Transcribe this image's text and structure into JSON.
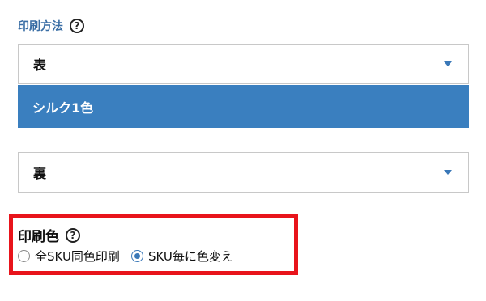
{
  "print_method": {
    "label": "印刷方法",
    "help": "?",
    "front_select": {
      "value": "表"
    },
    "front_highlight_option": "シルク1色",
    "back_select": {
      "value": "裏"
    }
  },
  "print_color": {
    "label": "印刷色",
    "help": "?",
    "options": [
      {
        "label": "全SKU同色印刷",
        "checked": false
      },
      {
        "label": "SKU毎に色変え",
        "checked": true
      }
    ]
  },
  "colors": {
    "accent": "#3a7fbf",
    "highlight_border": "#e8141b"
  }
}
